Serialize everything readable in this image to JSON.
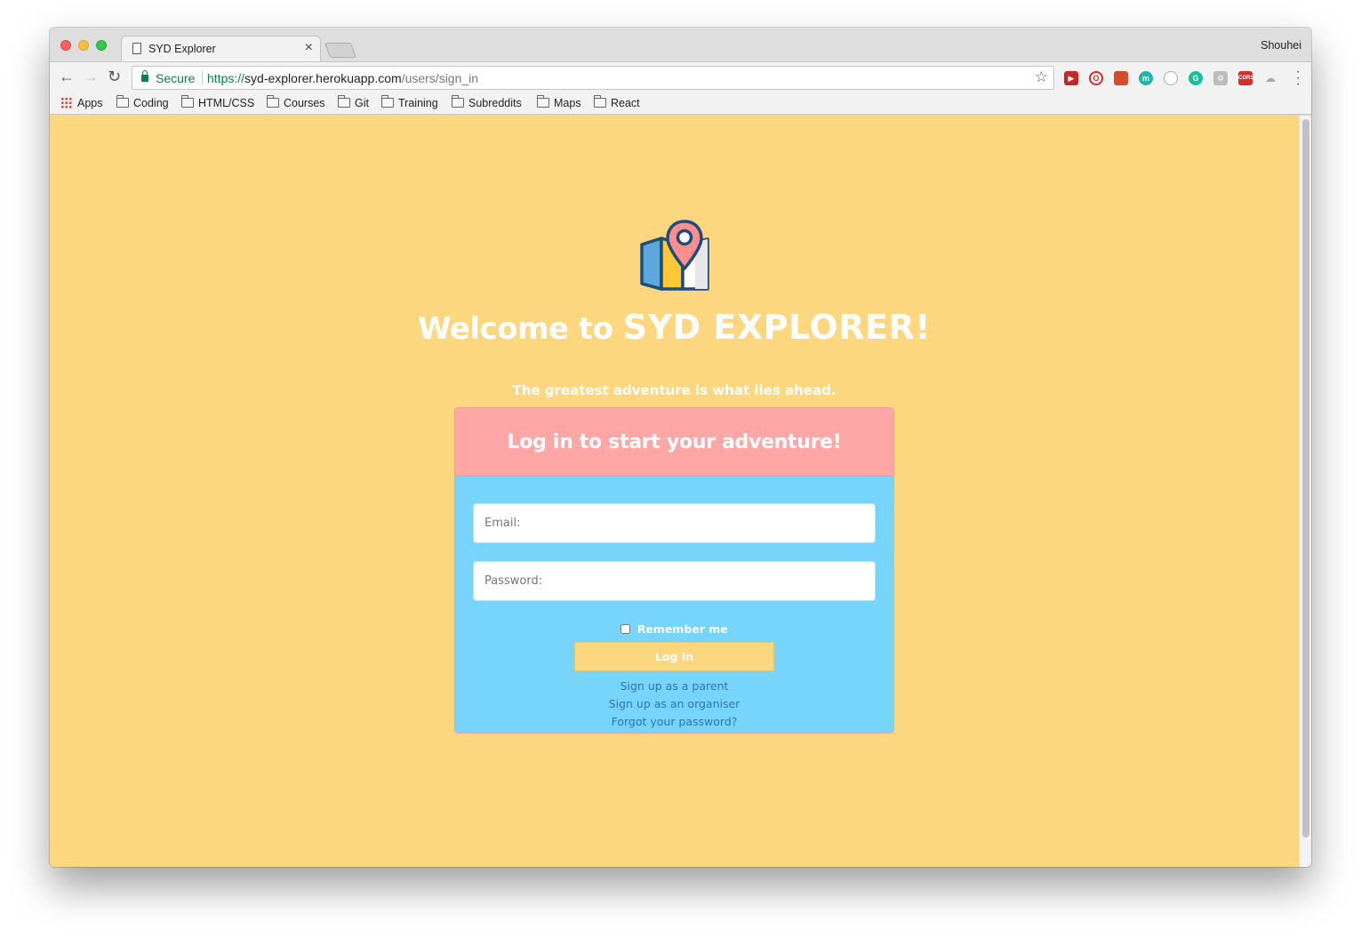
{
  "browser": {
    "tab_title": "SYD Explorer",
    "tab_close": "×",
    "profile_name": "Shouhei",
    "secure_label": "Secure",
    "url_scheme": "https://",
    "url_host": "syd-explorer.herokuapp.com",
    "url_path": "/users/sign_in",
    "bookmarks": [
      "Apps",
      "Coding",
      "HTML/CSS",
      "Courses",
      "Git",
      "Training",
      "Subreddits",
      "Maps",
      "React"
    ],
    "extensions": [
      "pushbullet-icon",
      "opera-icon",
      "book-icon",
      "m-icon",
      "circle-icon",
      "grammarly-icon",
      "gear-ext-icon",
      "cors-icon",
      "cloud-icon"
    ],
    "cors_label": "CORS",
    "m_label": "m",
    "g_label": "G"
  },
  "page": {
    "welcome_prefix": "Welcome to ",
    "welcome_brand": "SYD EXPLORER!",
    "tagline": "The greatest adventure is what lies ahead.",
    "card_title": "Log in to start your adventure!",
    "email_placeholder": "Email:",
    "password_placeholder": "Password:",
    "remember_label": "Remember me",
    "remember_checked": false,
    "login_button": "Log in",
    "links": {
      "signup_parent": "Sign up as a parent",
      "signup_organiser": "Sign up as an organiser",
      "forgot_password": "Forgot your password?"
    }
  },
  "colors": {
    "page_background": "#fdd77f",
    "card_header": "#ffa6a6",
    "card_body": "#77d4fb",
    "link": "#3173b5"
  }
}
